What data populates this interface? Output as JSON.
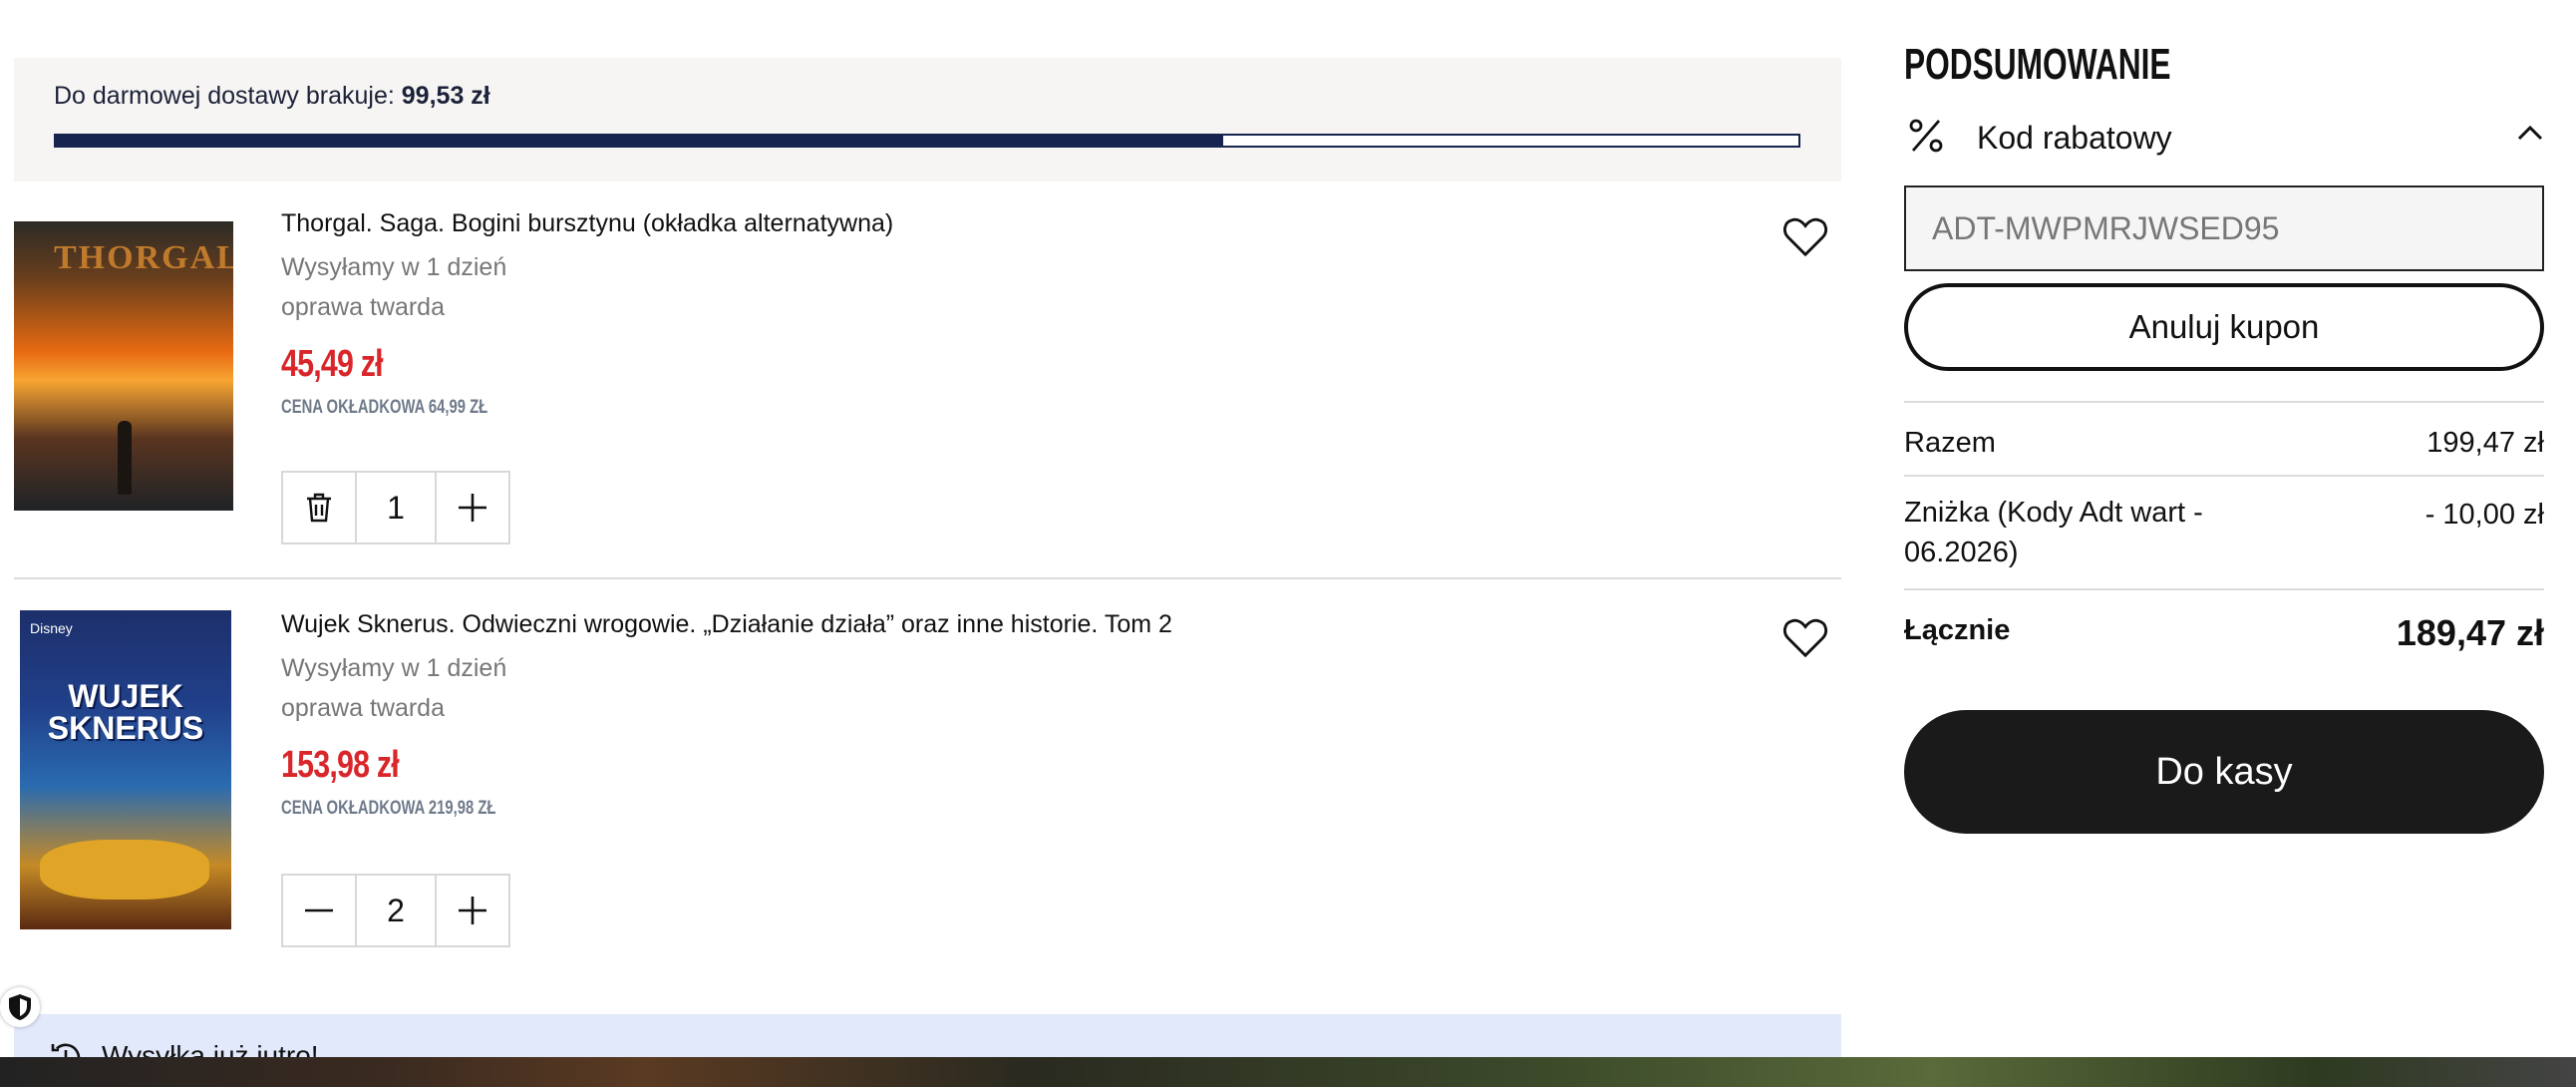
{
  "shipping": {
    "label": "Do darmowej dostawy brakuje:",
    "amount": "99,53 zł",
    "progress_fraction": 0.67
  },
  "cart": {
    "items": [
      {
        "title": "Thorgal. Saga. Bogini bursztynu (okładka alternatywna)",
        "shipping": "Wysyłamy w 1 dzień",
        "binding": "oprawa twarda",
        "price": "45,49 zł",
        "cover_price": "cena okładkowa 64,99 zł",
        "quantity": "1",
        "cover_text": "THORGAL"
      },
      {
        "title": "Wujek Sknerus. Odwieczni wrogowie. „Działanie działa” oraz inne historie. Tom 2",
        "shipping": "Wysyłamy w 1 dzień",
        "binding": "oprawa twarda",
        "price": "153,98 zł",
        "cover_price": "cena okładkowa 219,98 zł",
        "quantity": "2",
        "cover_brand": "Disney",
        "cover_text": "WUJEK SKNERUS"
      }
    ]
  },
  "delivery_banner": {
    "text": "Wysyłka już jutro!"
  },
  "summary": {
    "title": "PODSUMOWANIE",
    "coupon_label": "Kod rabatowy",
    "coupon_value": "ADT-MWPMRJWSED95",
    "cancel_coupon": "Anuluj kupon",
    "subtotal_label": "Razem",
    "subtotal_value": "199,47 zł",
    "discount_label": "Zniżka (Kody Adt wart - 06.2026)",
    "discount_value": "- 10,00 zł",
    "total_label": "Łącznie",
    "total_value": "189,47 zł",
    "checkout": "Do kasy"
  },
  "colors": {
    "accent_navy": "#17244f",
    "price_red": "#d9262b",
    "button_dark": "#1a1a1a",
    "banner_blue": "#e2e9fb"
  },
  "icons": [
    "trash-icon",
    "plus-icon",
    "minus-icon",
    "heart-icon",
    "percent-icon",
    "chevron-up-icon",
    "history-icon",
    "shield-icon"
  ]
}
